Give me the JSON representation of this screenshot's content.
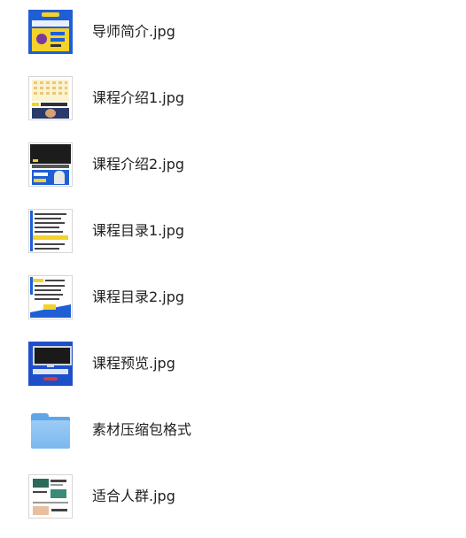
{
  "files": [
    {
      "name": "导师简介.jpg",
      "icon": "image-thumbnail-icon"
    },
    {
      "name": "课程介绍1.jpg",
      "icon": "image-thumbnail-icon"
    },
    {
      "name": "课程介绍2.jpg",
      "icon": "image-thumbnail-icon"
    },
    {
      "name": "课程目录1.jpg",
      "icon": "image-thumbnail-icon"
    },
    {
      "name": "课程目录2.jpg",
      "icon": "image-thumbnail-icon"
    },
    {
      "name": "课程预览.jpg",
      "icon": "image-thumbnail-icon"
    },
    {
      "name": "素材压缩包格式",
      "icon": "folder-icon"
    },
    {
      "name": "适合人群.jpg",
      "icon": "image-thumbnail-icon"
    }
  ],
  "colors": {
    "folder": "#7ab8f0",
    "folder_tab": "#5ea6e8",
    "text": "#1f1f1f",
    "thumb_blue": "#1f5fd6",
    "thumb_yellow": "#f5d22a"
  }
}
